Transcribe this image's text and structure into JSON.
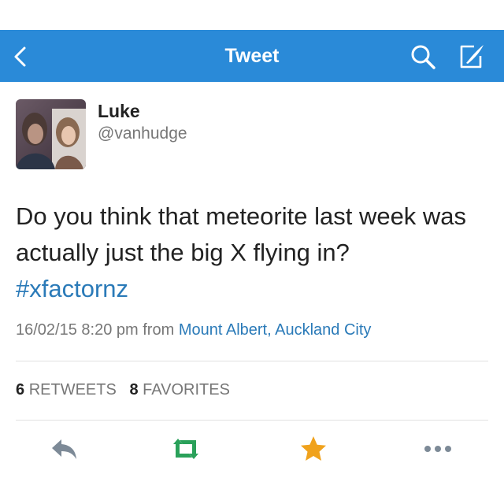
{
  "header": {
    "title": "Tweet",
    "back_icon": "chevron-left-icon",
    "search_icon": "search-icon",
    "compose_icon": "compose-icon",
    "bar_color": "#2a8ad8"
  },
  "tweet": {
    "author_name": "Luke",
    "author_handle": "@vanhudge",
    "text": "Do you think that meteorite last week was actually just the big X flying in?",
    "hashtag": "#xfactornz",
    "timestamp": "16/02/15 8:20 pm",
    "from_label": "from",
    "location": "Mount Albert, Auckland City",
    "link_color": "#2a7ab8"
  },
  "stats": {
    "retweets_count": "6",
    "retweets_label": "RETWEETS",
    "favorites_count": "8",
    "favorites_label": "FAVORITES"
  },
  "actions": {
    "reply_icon": "reply-icon",
    "retweet_icon": "retweet-icon",
    "favorite_icon": "star-icon",
    "more_icon": "more-icon",
    "retweet_color": "#2aa15a",
    "favorite_color": "#f0a21c",
    "neutral_color": "#7d8a97"
  }
}
